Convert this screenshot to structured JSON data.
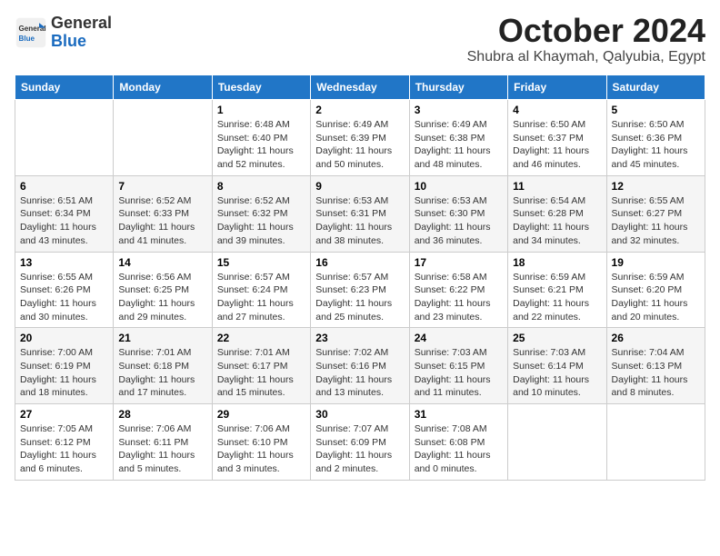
{
  "header": {
    "logo": {
      "general": "General",
      "blue": "Blue"
    },
    "month": "October 2024",
    "location": "Shubra al Khaymah, Qalyubia, Egypt"
  },
  "days_of_week": [
    "Sunday",
    "Monday",
    "Tuesday",
    "Wednesday",
    "Thursday",
    "Friday",
    "Saturday"
  ],
  "weeks": [
    [
      {
        "day": "",
        "detail": ""
      },
      {
        "day": "",
        "detail": ""
      },
      {
        "day": "1",
        "detail": "Sunrise: 6:48 AM\nSunset: 6:40 PM\nDaylight: 11 hours and 52 minutes."
      },
      {
        "day": "2",
        "detail": "Sunrise: 6:49 AM\nSunset: 6:39 PM\nDaylight: 11 hours and 50 minutes."
      },
      {
        "day": "3",
        "detail": "Sunrise: 6:49 AM\nSunset: 6:38 PM\nDaylight: 11 hours and 48 minutes."
      },
      {
        "day": "4",
        "detail": "Sunrise: 6:50 AM\nSunset: 6:37 PM\nDaylight: 11 hours and 46 minutes."
      },
      {
        "day": "5",
        "detail": "Sunrise: 6:50 AM\nSunset: 6:36 PM\nDaylight: 11 hours and 45 minutes."
      }
    ],
    [
      {
        "day": "6",
        "detail": "Sunrise: 6:51 AM\nSunset: 6:34 PM\nDaylight: 11 hours and 43 minutes."
      },
      {
        "day": "7",
        "detail": "Sunrise: 6:52 AM\nSunset: 6:33 PM\nDaylight: 11 hours and 41 minutes."
      },
      {
        "day": "8",
        "detail": "Sunrise: 6:52 AM\nSunset: 6:32 PM\nDaylight: 11 hours and 39 minutes."
      },
      {
        "day": "9",
        "detail": "Sunrise: 6:53 AM\nSunset: 6:31 PM\nDaylight: 11 hours and 38 minutes."
      },
      {
        "day": "10",
        "detail": "Sunrise: 6:53 AM\nSunset: 6:30 PM\nDaylight: 11 hours and 36 minutes."
      },
      {
        "day": "11",
        "detail": "Sunrise: 6:54 AM\nSunset: 6:28 PM\nDaylight: 11 hours and 34 minutes."
      },
      {
        "day": "12",
        "detail": "Sunrise: 6:55 AM\nSunset: 6:27 PM\nDaylight: 11 hours and 32 minutes."
      }
    ],
    [
      {
        "day": "13",
        "detail": "Sunrise: 6:55 AM\nSunset: 6:26 PM\nDaylight: 11 hours and 30 minutes."
      },
      {
        "day": "14",
        "detail": "Sunrise: 6:56 AM\nSunset: 6:25 PM\nDaylight: 11 hours and 29 minutes."
      },
      {
        "day": "15",
        "detail": "Sunrise: 6:57 AM\nSunset: 6:24 PM\nDaylight: 11 hours and 27 minutes."
      },
      {
        "day": "16",
        "detail": "Sunrise: 6:57 AM\nSunset: 6:23 PM\nDaylight: 11 hours and 25 minutes."
      },
      {
        "day": "17",
        "detail": "Sunrise: 6:58 AM\nSunset: 6:22 PM\nDaylight: 11 hours and 23 minutes."
      },
      {
        "day": "18",
        "detail": "Sunrise: 6:59 AM\nSunset: 6:21 PM\nDaylight: 11 hours and 22 minutes."
      },
      {
        "day": "19",
        "detail": "Sunrise: 6:59 AM\nSunset: 6:20 PM\nDaylight: 11 hours and 20 minutes."
      }
    ],
    [
      {
        "day": "20",
        "detail": "Sunrise: 7:00 AM\nSunset: 6:19 PM\nDaylight: 11 hours and 18 minutes."
      },
      {
        "day": "21",
        "detail": "Sunrise: 7:01 AM\nSunset: 6:18 PM\nDaylight: 11 hours and 17 minutes."
      },
      {
        "day": "22",
        "detail": "Sunrise: 7:01 AM\nSunset: 6:17 PM\nDaylight: 11 hours and 15 minutes."
      },
      {
        "day": "23",
        "detail": "Sunrise: 7:02 AM\nSunset: 6:16 PM\nDaylight: 11 hours and 13 minutes."
      },
      {
        "day": "24",
        "detail": "Sunrise: 7:03 AM\nSunset: 6:15 PM\nDaylight: 11 hours and 11 minutes."
      },
      {
        "day": "25",
        "detail": "Sunrise: 7:03 AM\nSunset: 6:14 PM\nDaylight: 11 hours and 10 minutes."
      },
      {
        "day": "26",
        "detail": "Sunrise: 7:04 AM\nSunset: 6:13 PM\nDaylight: 11 hours and 8 minutes."
      }
    ],
    [
      {
        "day": "27",
        "detail": "Sunrise: 7:05 AM\nSunset: 6:12 PM\nDaylight: 11 hours and 6 minutes."
      },
      {
        "day": "28",
        "detail": "Sunrise: 7:06 AM\nSunset: 6:11 PM\nDaylight: 11 hours and 5 minutes."
      },
      {
        "day": "29",
        "detail": "Sunrise: 7:06 AM\nSunset: 6:10 PM\nDaylight: 11 hours and 3 minutes."
      },
      {
        "day": "30",
        "detail": "Sunrise: 7:07 AM\nSunset: 6:09 PM\nDaylight: 11 hours and 2 minutes."
      },
      {
        "day": "31",
        "detail": "Sunrise: 7:08 AM\nSunset: 6:08 PM\nDaylight: 11 hours and 0 minutes."
      },
      {
        "day": "",
        "detail": ""
      },
      {
        "day": "",
        "detail": ""
      }
    ]
  ]
}
